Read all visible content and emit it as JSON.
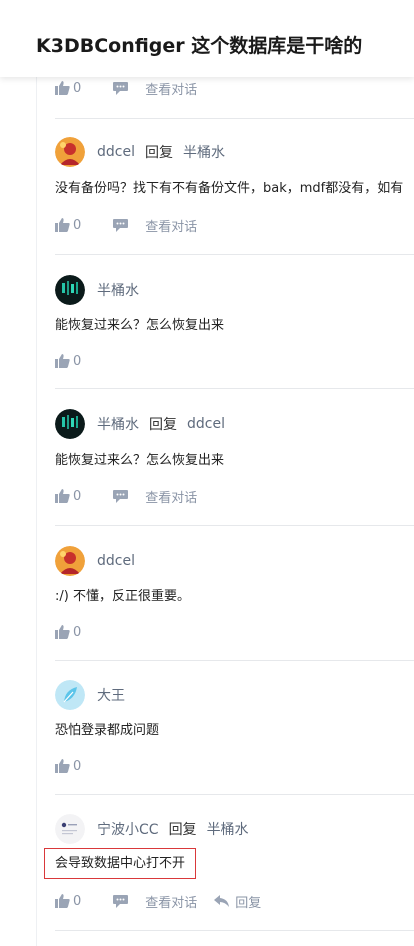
{
  "header": {
    "title": "K3DBConfiger 这个数据库是干啥的"
  },
  "top_partial": {
    "like_count": "0",
    "view_chat_label": "查看对话"
  },
  "comments": [
    {
      "user": "ddcel",
      "reply_word": "回复",
      "target": "半桶水",
      "text": "没有备份吗？找下有不有备份文件，bak，mdf都没有，如有",
      "like_count": "0",
      "view_chat_label": "查看对话"
    },
    {
      "user": "半桶水",
      "text": "能恢复过来么？怎么恢复出来",
      "like_count": "0"
    },
    {
      "user": "半桶水",
      "reply_word": "回复",
      "target": "ddcel",
      "text": "能恢复过来么？怎么恢复出来",
      "like_count": "0",
      "view_chat_label": "查看对话"
    },
    {
      "user": "ddcel",
      "text": ":/) 不懂，反正很重要。",
      "like_count": "0"
    },
    {
      "user": "大王",
      "text": "恐怕登录都成问题",
      "like_count": "0"
    },
    {
      "user": "宁波小CC",
      "reply_word": "回复",
      "target": "半桶水",
      "text": "会导致数据中心打不开",
      "like_count": "0",
      "view_chat_label": "查看对话",
      "reply_label": "回复"
    }
  ],
  "icons": {
    "like": "thumbs-up-icon",
    "chat": "chat-bubble-icon",
    "reply": "reply-arrow-icon"
  },
  "colors": {
    "icon_gray": "#9aa4b5",
    "meta_text": "#5f6b7d",
    "highlight_border": "#d9383a"
  }
}
